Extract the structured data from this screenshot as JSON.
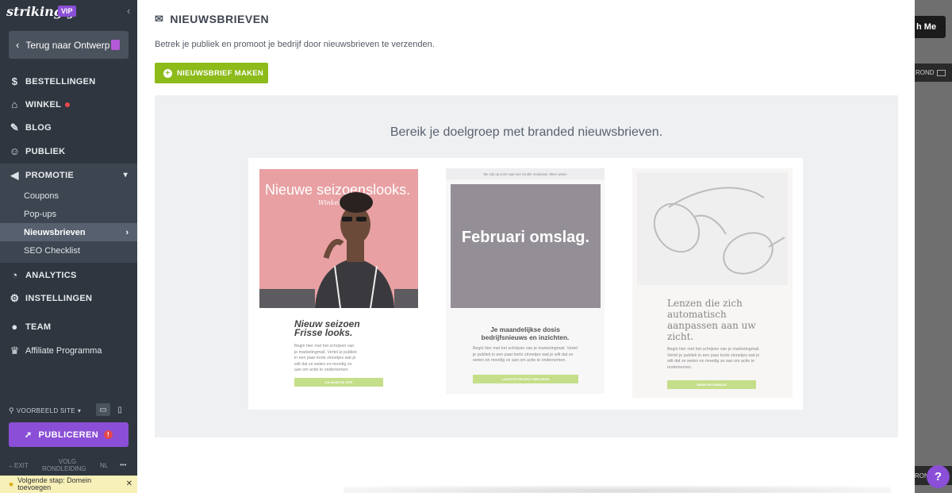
{
  "sidebar": {
    "logo": "strikingly",
    "vip_badge": "VIP",
    "back_button": "Terug naar Ontwerp",
    "nav": [
      {
        "label": "BESTELLINGEN",
        "icon": "dollar-icon"
      },
      {
        "label": "WINKEL",
        "icon": "store-icon",
        "has_dot": true
      },
      {
        "label": "BLOG",
        "icon": "pen-icon"
      },
      {
        "label": "PUBLIEK",
        "icon": "audience-icon"
      },
      {
        "label": "PROMOTIE",
        "icon": "megaphone-icon",
        "active": true
      },
      {
        "label": "ANALYTICS",
        "icon": "pie-chart-icon"
      },
      {
        "label": "INSTELLINGEN",
        "icon": "gear-icon"
      },
      {
        "label": "TEAM",
        "icon": "team-icon"
      },
      {
        "label": "Affiliate Programma",
        "icon": "trophy-icon"
      }
    ],
    "sub_items": [
      {
        "label": "Coupons"
      },
      {
        "label": "Pop-ups"
      },
      {
        "label": "Nieuwsbrieven",
        "active": true
      },
      {
        "label": "SEO Checklist"
      }
    ],
    "preview_site": "VOORBEELD SITE",
    "publish": "PUBLICEREN",
    "bottom": {
      "exit": "EXIT",
      "tour_line1": "VOLG",
      "tour_line2": "RONDLEIDING",
      "lang": "NL",
      "more": "•••"
    },
    "next_step": "Volgende stap: Domein toevoegen"
  },
  "right_strip": {
    "button_text": "h Me",
    "bar_text": "ROND",
    "bar_text_bottom": "RON"
  },
  "main": {
    "title": "NIEUWSBRIEVEN",
    "subtitle": "Betrek je publiek en promoot je bedrijf door nieuwsbrieven te verzenden.",
    "make_button": "NIEUWSBRIEF MAKEN",
    "promo_heading": "Bereik je doelgroep met branded nieuwsbrieven.",
    "templates": [
      {
        "image_title": "Nieuwe seizoenslooks.",
        "image_subtitle": "Winkelcollectie",
        "heading": "Nieuw seizoen Frisse looks.",
        "body": "Begin hier met het schrijven van je marketingmail. Vertel je publiek in een paar korte zinnetjes wat je wilt dat ze weten en moedig ze aan om actie te ondernemen.",
        "button": "GA NAAR DE SITE"
      },
      {
        "top_bar": "We zijn op onze naar een zonder ontwerper. Meer weten",
        "image_text": "Februari omslag.",
        "heading": "Je maandelijkse dosis bedrijfsnieuws en inzichten.",
        "body": "Begin hier met het schrijven van je marketingmail. Vertel je publiek in een paar korte zinnetjes wat je wilt dat ze weten en moedig ze aan om actie te ondernemen.",
        "button": "LAATSTE PROJECT BEKIJKEN"
      },
      {
        "heading": "Lenzen die zich automatisch aanpassen aan uw zicht.",
        "body": "Begin hier met het schrijven van je marketingmail. Vertel je publiek in een paar korte zinnetjes wat je wilt dat ze weten en moedig ze aan om actie te ondernemen.",
        "button": "MEER INFORMATIE"
      }
    ]
  },
  "colors": {
    "sidebar_bg": "#2f3640",
    "accent_purple": "#8a4fd6",
    "green": "#8cbb1a",
    "promo_bg": "#eef0f2"
  }
}
